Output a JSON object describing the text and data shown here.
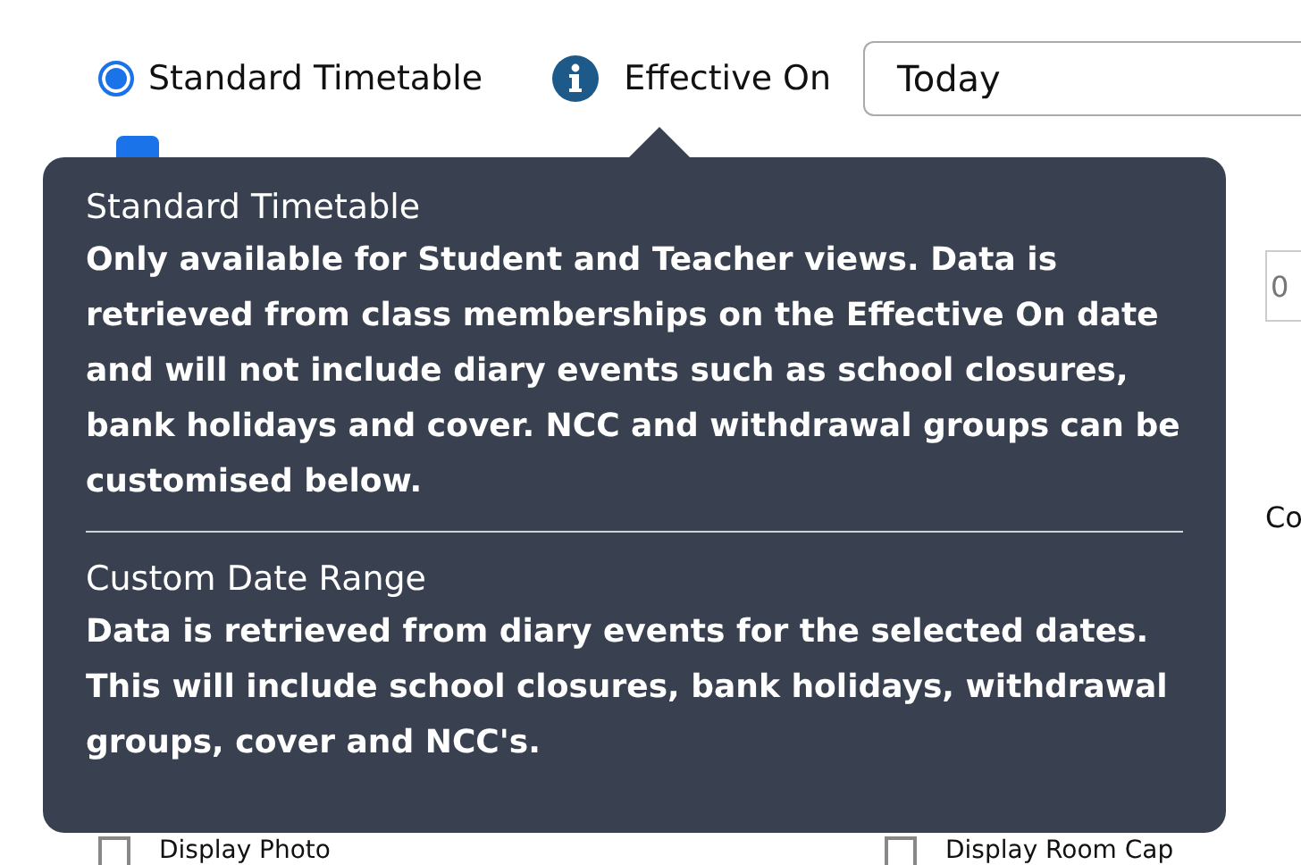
{
  "timetable_option": {
    "label": "Standard Timetable",
    "selected": true
  },
  "effective_on": {
    "label": "Effective On",
    "value": "Today"
  },
  "withdrawal_checkbox": {
    "checked": true
  },
  "right_field": {
    "value": "0"
  },
  "right_label": "Co",
  "display_options": [
    {
      "label": "Display Photo",
      "checked": false
    },
    {
      "label": "Display Room Cap",
      "checked": false
    }
  ],
  "tooltip": {
    "sections": [
      {
        "title": "Standard Timetable",
        "body": "Only available for Student and Teacher views. Data is retrieved from class memberships on the Effective On date and will not include diary events such as school closures, bank holidays and cover. NCC and withdrawal groups can be customised below."
      },
      {
        "title": "Custom Date Range",
        "body": "Data is retrieved from diary events for the selected dates. This will include school closures, bank holidays, withdrawal groups, cover and NCC's."
      }
    ]
  }
}
